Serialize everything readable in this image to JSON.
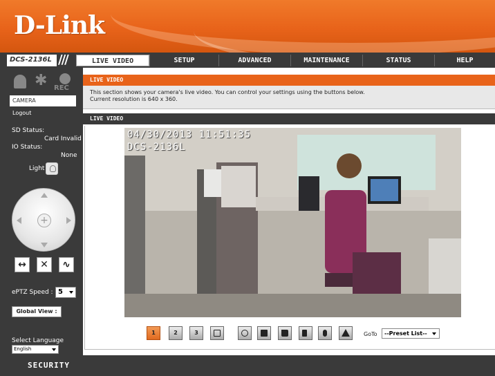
{
  "brand": {
    "logo": "D-Link",
    "model": "DCS-2136L",
    "slashes": "///",
    "footer": "SECURITY",
    "accent": "#e8631a"
  },
  "nav": {
    "tabs": [
      {
        "label": "LIVE VIDEO",
        "active": true
      },
      {
        "label": "SETUP"
      },
      {
        "label": "ADVANCED"
      },
      {
        "label": "MAINTENANCE"
      },
      {
        "label": "STATUS"
      },
      {
        "label": "HELP"
      }
    ]
  },
  "sidebar": {
    "status_icons": {
      "rec": "REC"
    },
    "camera_link": "CAMERA",
    "logout_link": "Logout",
    "sd_status_label": "SD Status:",
    "sd_status_value": "Card Invalid",
    "io_status_label": "IO Status:",
    "io_status_value": "None",
    "light_label": "Light",
    "ptz_center": "+",
    "controls": {
      "expand": "↔",
      "stop": "✕",
      "patrol": "∿"
    },
    "speed_label": "ePTZ Speed :",
    "speed_value": "5",
    "global_view": "Global View :",
    "language_label": "Select Language",
    "language_value": "English"
  },
  "main": {
    "section_title": "LIVE VIDEO",
    "description_line1": "This section shows your camera's live video. You can control your settings using the buttons below.",
    "description_line2": "Current resolution is 640 x 360.",
    "panel_title": "LIVE VIDEO",
    "video": {
      "timestamp": "04/30/2013 11:51:35",
      "camera_name": "DCS-2136L"
    },
    "toolbar": {
      "profiles": [
        "1",
        "2",
        "3"
      ],
      "goto_label": "GoTo",
      "preset_value": "--Preset List--"
    }
  }
}
